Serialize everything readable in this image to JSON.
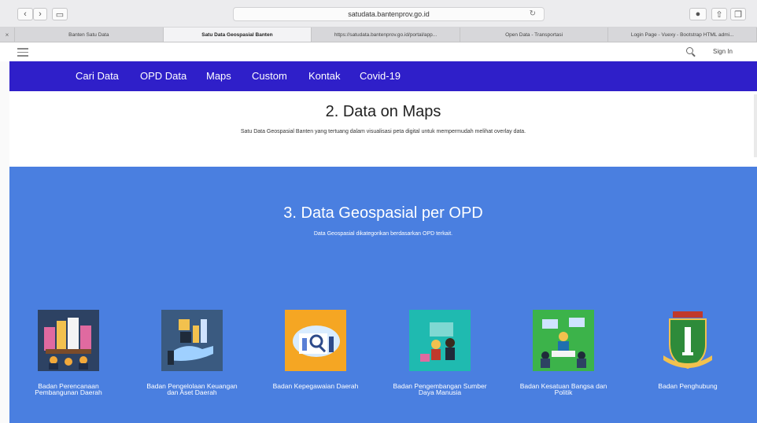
{
  "browser": {
    "url": "satudata.bantenprov.go.id",
    "tabs": [
      {
        "label": "Banten Satu Data"
      },
      {
        "label": "Satu Data Geospasial Banten",
        "active": true
      },
      {
        "label": "https://satudata.bantenprov.go.id/portal/app..."
      },
      {
        "label": "Open Data - Transportasi"
      },
      {
        "label": "Login Page - Vuexy - Bootstrap HTML admi..."
      }
    ]
  },
  "site": {
    "sign_in": "Sign In",
    "nav": [
      "Cari Data",
      "OPD Data",
      "Maps",
      "Custom",
      "Kontak",
      "Covid-19"
    ]
  },
  "section2": {
    "title": "2. Data on Maps",
    "subtitle": "Satu Data Geospasial Banten yang tertuang dalam visualisasi peta digital untuk mempermudah melihat overlay data."
  },
  "section3": {
    "title": "3. Data Geospasial per OPD",
    "subtitle": "Data Geospasial dikategorikan berdasarkan OPD terkait.",
    "cards": [
      {
        "label": "Badan Perencanaan Pembangunan Daerah",
        "icon": "planning-icon"
      },
      {
        "label": "Badan Pengelolaan Keuangan dan Aset Daerah",
        "icon": "finance-icon"
      },
      {
        "label": "Badan Kepegawaian Daerah",
        "icon": "personnel-icon"
      },
      {
        "label": "Badan Pengembangan Sumber Daya Manusia",
        "icon": "hr-development-icon"
      },
      {
        "label": "Badan Kesatuan Bangsa dan Politik",
        "icon": "politics-icon"
      },
      {
        "label": "Badan Penghubung",
        "icon": "banten-emblem-icon"
      }
    ]
  },
  "colors": {
    "nav": "#2f1fc9",
    "section3": "#4a7fe0"
  }
}
